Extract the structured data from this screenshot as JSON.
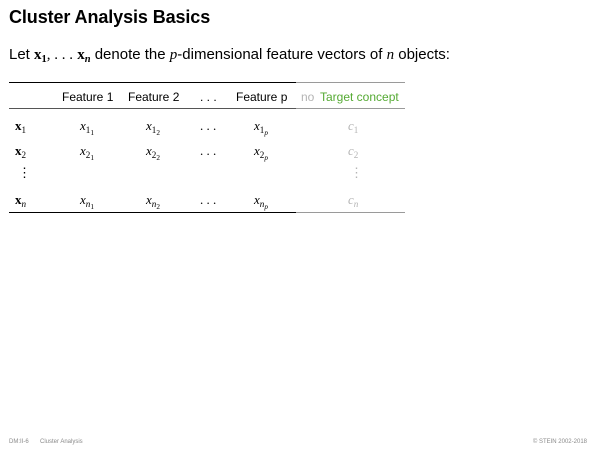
{
  "title": "Cluster Analysis Basics",
  "intro": {
    "prefix": "Let",
    "x_first": "x",
    "x_first_sub": "1",
    "ellipsis": ", . . .",
    "x_last": "x",
    "x_last_sub": "n",
    "middle": "denote the",
    "p": "p",
    "dimensional": "-dimensional feature vectors of",
    "n": "n",
    "suffix": "objects:"
  },
  "table": {
    "headers": {
      "feature1": "Feature 1",
      "feature2": "Feature 2",
      "dots": ". . .",
      "featurep": "Feature p",
      "no": "no",
      "target": "Target concept"
    },
    "rows": [
      {
        "label": "x",
        "label_sub": "1",
        "c1_sub": "1",
        "c1_subsub": "1",
        "c2_sub": "1",
        "c2_subsub": "2",
        "dots": ". . .",
        "cp_sub": "1",
        "cp_subsub": "p",
        "target": "c",
        "target_sub": "1"
      },
      {
        "label": "x",
        "label_sub": "2",
        "c1_sub": "2",
        "c1_subsub": "1",
        "c2_sub": "2",
        "c2_subsub": "2",
        "dots": ". . .",
        "cp_sub": "2",
        "cp_subsub": "p",
        "target": "c",
        "target_sub": "2"
      },
      {
        "label": "⋮",
        "target": "⋮"
      },
      {
        "label": "x",
        "label_sub": "n",
        "c1_sub": "n",
        "c1_subsub": "1",
        "c2_sub": "n",
        "c2_subsub": "2",
        "dots": ". . .",
        "cp_sub": "n",
        "cp_subsub": "p",
        "target": "c",
        "target_sub": "n"
      }
    ],
    "cell_var": "x"
  },
  "footer": {
    "left": "DM:II-6",
    "section": "Cluster Analysis",
    "right": "© STEIN 2002-2018"
  },
  "colors": {
    "accent_green": "#55aa33",
    "muted_gray": "#b4b4b4"
  }
}
